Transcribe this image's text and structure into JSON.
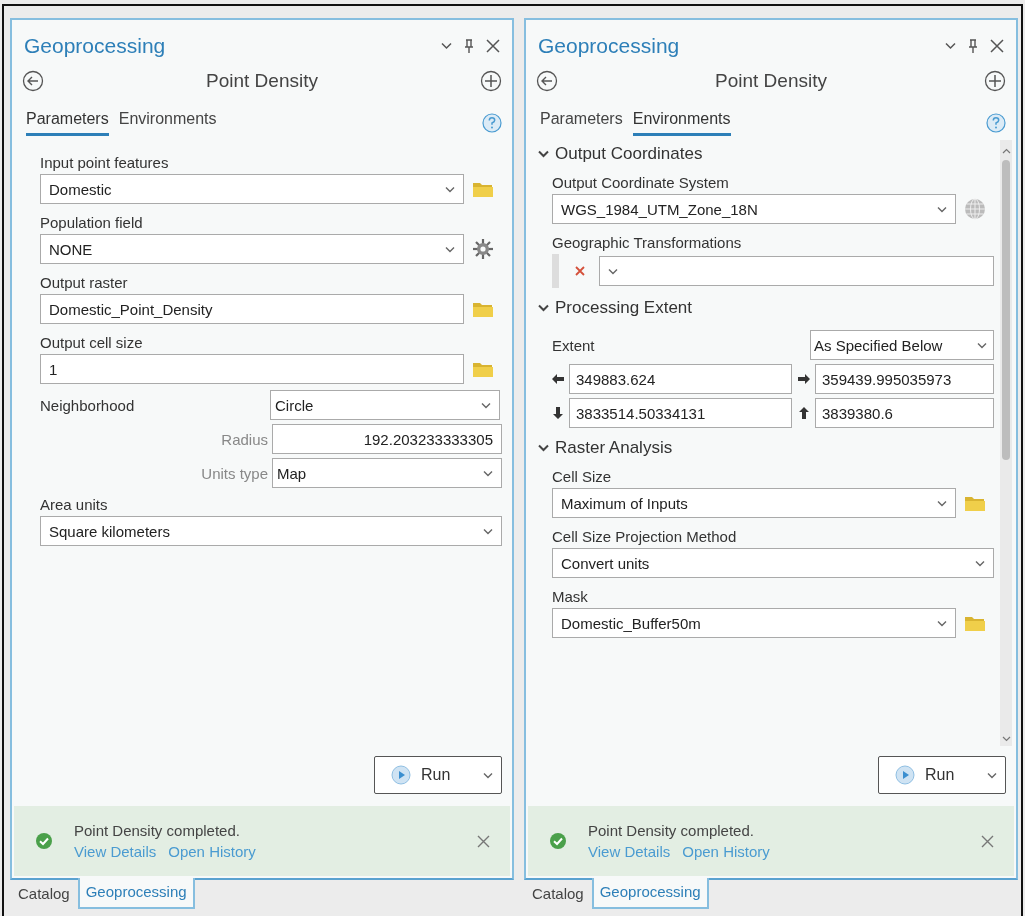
{
  "panels": [
    {
      "title": "Geoprocessing",
      "tool": "Point Density",
      "tabs": [
        {
          "label": "Parameters",
          "selected": true
        },
        {
          "label": "Environments",
          "selected": false
        }
      ],
      "scrollable": false,
      "items": [
        {
          "kind": "field",
          "label": "Input point features",
          "value": "Domestic",
          "dropdown": true,
          "button": {
            "kind": "folder"
          }
        },
        {
          "kind": "field",
          "label": "Population field",
          "value": "NONE",
          "dropdown": true,
          "button": {
            "kind": "gear"
          }
        },
        {
          "kind": "field",
          "label": "Output raster",
          "value": "Domestic_Point_Density",
          "dropdown": false,
          "button": {
            "kind": "folder"
          }
        },
        {
          "kind": "field",
          "label": "Output cell size",
          "value": "1",
          "dropdown": false,
          "button": {
            "kind": "folder"
          }
        },
        {
          "kind": "inline",
          "label": "Neighborhood",
          "value": "Circle",
          "dropdown": true
        },
        {
          "kind": "sub",
          "label": "Radius",
          "value": "192.203233333305",
          "dropdown": false
        },
        {
          "kind": "sub",
          "label": "Units type",
          "value": "Map",
          "dropdown": true
        },
        {
          "kind": "field",
          "label": "Area units",
          "value": "Square kilometers",
          "dropdown": true
        }
      ],
      "run": "Run",
      "status": {
        "message": "Point Density completed.",
        "links": [
          "View Details",
          "Open History"
        ]
      },
      "dock_tabs": [
        {
          "label": "Catalog",
          "selected": false
        },
        {
          "label": "Geoprocessing",
          "selected": true
        }
      ]
    },
    {
      "title": "Geoprocessing",
      "tool": "Point Density",
      "tabs": [
        {
          "label": "Parameters",
          "selected": false
        },
        {
          "label": "Environments",
          "selected": true
        }
      ],
      "scrollable": true,
      "items": [
        {
          "kind": "section",
          "title": "Output Coordinates",
          "expanded": true,
          "children": [
            {
              "kind": "field",
              "label": "Output Coordinate System",
              "value": "WGS_1984_UTM_Zone_18N",
              "dropdown": true,
              "button": {
                "kind": "globe"
              }
            },
            {
              "kind": "transform",
              "label": "Geographic Transformations",
              "dropdown": true
            }
          ]
        },
        {
          "kind": "section",
          "title": "Processing Extent",
          "expanded": true,
          "children": [
            {
              "kind": "extent",
              "label": "Extent",
              "value": "As Specified Below",
              "coords": [
                {
                  "kind": "left",
                  "value": "349883.624"
                },
                {
                  "kind": "right",
                  "value": "359439.995035973"
                },
                {
                  "kind": "down",
                  "value": "3833514.50334131"
                },
                {
                  "kind": "up",
                  "value": "3839380.6"
                }
              ]
            }
          ]
        },
        {
          "kind": "section",
          "title": "Raster Analysis",
          "expanded": true,
          "children": [
            {
              "kind": "field",
              "label": "Cell Size",
              "value": "Maximum of Inputs",
              "dropdown": true,
              "button": {
                "kind": "folder"
              }
            },
            {
              "kind": "field",
              "label": "Cell Size Projection Method",
              "value": "Convert units",
              "dropdown": true
            },
            {
              "kind": "field",
              "label": "Mask",
              "value": "Domestic_Buffer50m",
              "dropdown": true,
              "button": {
                "kind": "folder"
              }
            }
          ]
        }
      ],
      "run": "Run",
      "status": {
        "message": "Point Density completed.",
        "links": [
          "View Details",
          "Open History"
        ]
      },
      "dock_tabs": [
        {
          "label": "Catalog",
          "selected": false
        },
        {
          "label": "Geoprocessing",
          "selected": true
        }
      ]
    }
  ]
}
